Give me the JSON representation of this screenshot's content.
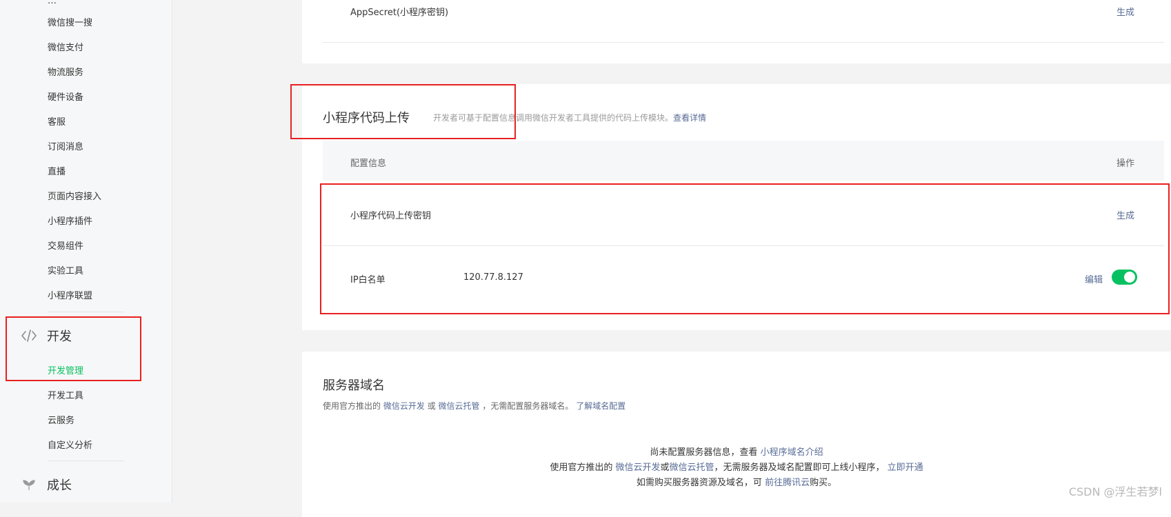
{
  "sidebar": {
    "items_top": [
      "微信搜一搜",
      "微信支付",
      "物流服务",
      "硬件设备",
      "客服",
      "订阅消息",
      "直播",
      "页面内容接入",
      "小程序插件",
      "交易组件",
      "实验工具",
      "小程序联盟"
    ],
    "dev_section": {
      "icon": "code-icon",
      "label": "开发",
      "items": [
        "开发管理",
        "开发工具",
        "云服务",
        "自定义分析"
      ]
    },
    "grow_section": {
      "icon": "sprout-icon",
      "label": "成长"
    }
  },
  "appsecret": {
    "label": "AppSecret(小程序密钥)",
    "action": "生成"
  },
  "code_upload": {
    "title": "小程序代码上传",
    "desc": "开发者可基于配置信息调用微信开发者工具提供的代码上传模块。",
    "desc_link": "查看详情",
    "col_config": "配置信息",
    "col_action": "操作",
    "rows": [
      {
        "label": "小程序代码上传密钥",
        "value": "",
        "action": "生成"
      },
      {
        "label": "IP白名单",
        "value": "120.77.8.127",
        "action": "编辑",
        "toggle_on": true
      }
    ]
  },
  "server_domain": {
    "title": "服务器域名",
    "desc_prefix": "使用官方推出的",
    "link1": "微信云开发",
    "or": "或",
    "link2": "微信云托管",
    "desc_suffix": "，无需配置服务器域名。",
    "link3": "了解域名配置",
    "empty_line1_prefix": "尚未配置服务器信息，查看",
    "empty_line1_link": "小程序域名介绍",
    "empty_line2_prefix": "使用官方推出的",
    "empty_line2_link1": "微信云开发",
    "empty_line2_or": "或",
    "empty_line2_link2": "微信云托管",
    "empty_line2_mid": "，无需服务器及域名配置即可上线小程序，",
    "empty_line2_link3": "立即开通",
    "empty_line3_prefix": "如需购买服务器资源及域名，可",
    "empty_line3_link": "前往腾讯云",
    "empty_line3_suffix": "购买。"
  },
  "watermark": "CSDN @浮生若梦l",
  "colors": {
    "accent_green": "#07c160",
    "link_blue": "#576b95",
    "annotation_red": "#ea1f1f"
  }
}
